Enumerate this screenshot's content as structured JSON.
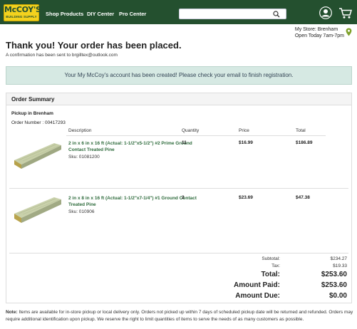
{
  "header": {
    "logo_main": "McCOY'S",
    "logo_sub": "BUILDING SUPPLY",
    "nav": [
      "Shop Products",
      "DIY Center",
      "Pro Center"
    ],
    "search": {
      "value": "",
      "placeholder": ""
    },
    "store_line1": "My Store: Brenham",
    "store_line2": "Open Today 7am-7pm",
    "brand_color": "#24502f",
    "logo_color": "#f3d21e"
  },
  "page": {
    "title": "Thank you! Your order has been placed.",
    "confirmation": "A confirmation has been sent to brgilltex@outlook.com",
    "banner": "Your My McCoy's account has been created! Please check your email to finish registration."
  },
  "summary": {
    "title": "Order Summary",
    "pickup": "Pickup in Brenham",
    "order_number": "Order Number : 00417293",
    "columns": [
      "Description",
      "Quantity",
      "Price",
      "Total"
    ],
    "items": [
      {
        "name": "2 in x 6 in x 16 ft (Actual: 1-1/2\"x5-1/2\") #2 Prime Ground Contact Treated Pine",
        "sku": "Sku: 01081200",
        "qty": "11",
        "price": "$16.99",
        "total": "$186.89"
      },
      {
        "name": "2 in x 8 in x 16 ft (Actual: 1-1/2\"x7-1/4\") #1 Ground Contact Treated Pine",
        "sku": "Sku: 010906",
        "qty": "2",
        "price": "$23.69",
        "total": "$47.38"
      }
    ],
    "totals": {
      "subtotal_label": "Subtotal:",
      "subtotal": "$234.27",
      "tax_label": "Tax:",
      "tax": "$19.33",
      "total_label": "Total:",
      "total": "$253.60",
      "paid_label": "Amount Paid:",
      "paid": "$253.60",
      "due_label": "Amount Due:",
      "due": "$0.00"
    }
  },
  "note": {
    "label": "Note:",
    "text": "Items are available for in-store pickup or local delivery only. Orders not picked up within 7 days of scheduled pickup date will be returned and refunded. Orders may require additional identification upon pickup. We reserve the right to limit quantities of items to serve the needs of as many customers as possible."
  }
}
